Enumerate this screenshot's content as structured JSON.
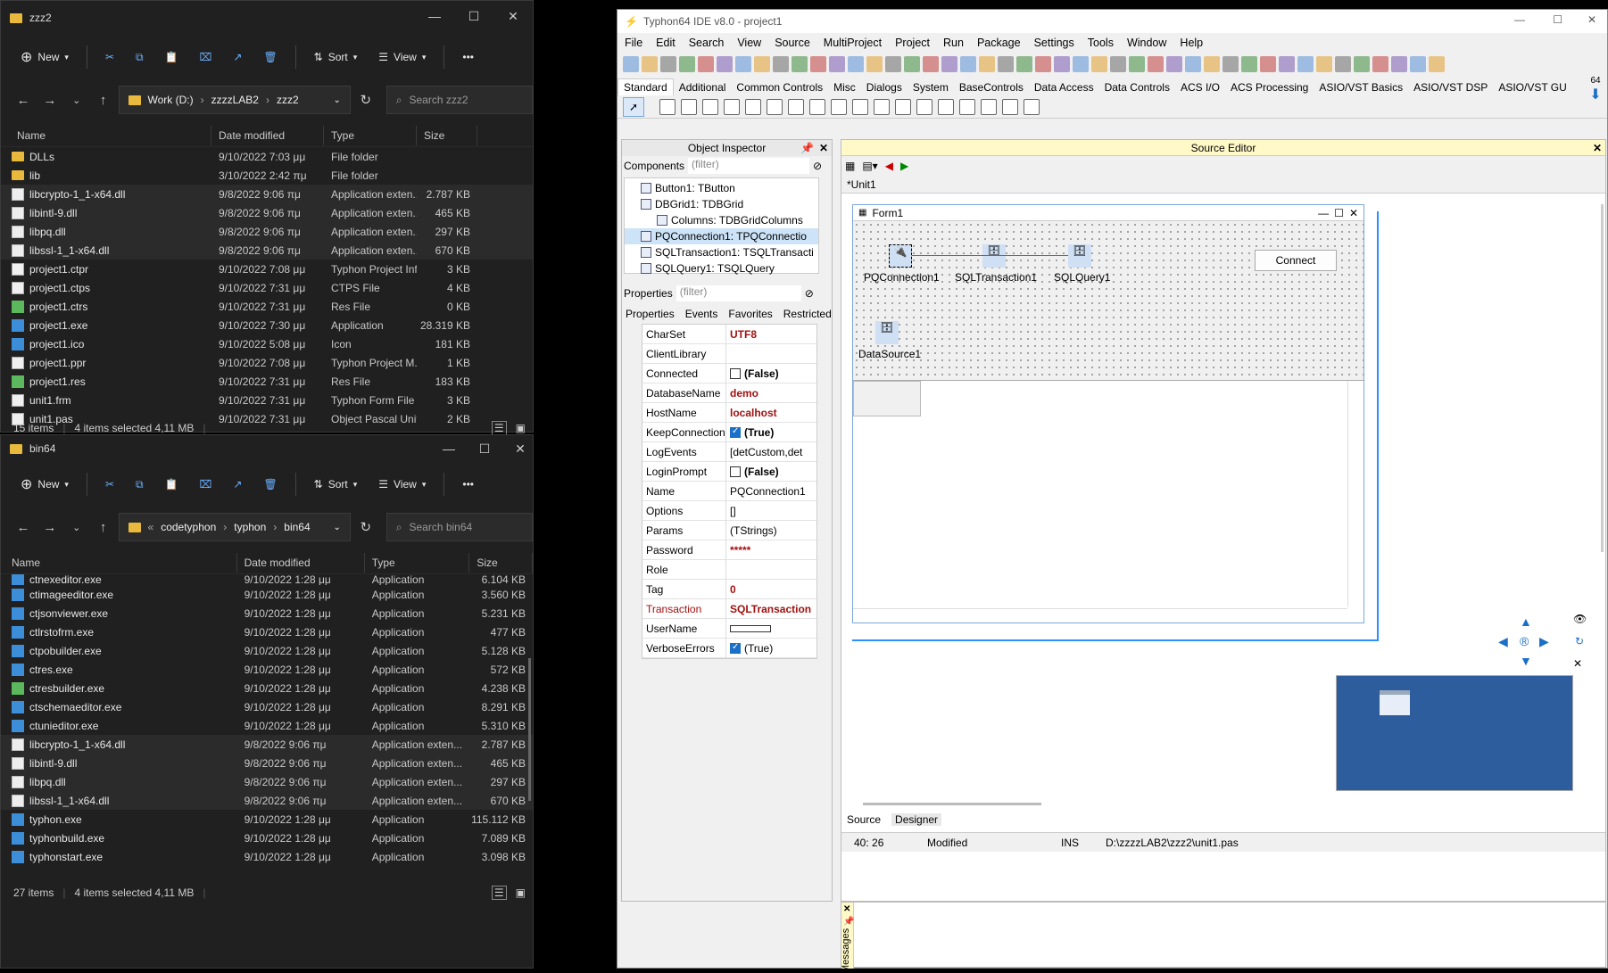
{
  "explorer1": {
    "title": "zzz2",
    "new_label": "New",
    "sort_label": "Sort",
    "view_label": "View",
    "path": [
      "Work (D:)",
      "zzzzLAB2",
      "zzz2"
    ],
    "search_placeholder": "Search zzz2",
    "columns": [
      "Name",
      "Date modified",
      "Type",
      "Size"
    ],
    "rows": [
      {
        "name": "DLLs",
        "date": "9/10/2022 7:03 μμ",
        "type": "File folder",
        "size": "",
        "icon": "folder",
        "sel": false
      },
      {
        "name": "lib",
        "date": "3/10/2022 2:42 πμ",
        "type": "File folder",
        "size": "",
        "icon": "folder",
        "sel": false
      },
      {
        "name": "libcrypto-1_1-x64.dll",
        "date": "9/8/2022 9:06 πμ",
        "type": "Application exten...",
        "size": "2.787 KB",
        "icon": "dll",
        "sel": true
      },
      {
        "name": "libintl-9.dll",
        "date": "9/8/2022 9:06 πμ",
        "type": "Application exten...",
        "size": "465 KB",
        "icon": "dll",
        "sel": true
      },
      {
        "name": "libpq.dll",
        "date": "9/8/2022 9:06 πμ",
        "type": "Application exten...",
        "size": "297 KB",
        "icon": "dll",
        "sel": true
      },
      {
        "name": "libssl-1_1-x64.dll",
        "date": "9/8/2022 9:06 πμ",
        "type": "Application exten...",
        "size": "670 KB",
        "icon": "dll",
        "sel": true
      },
      {
        "name": "project1.ctpr",
        "date": "9/10/2022 7:08 μμ",
        "type": "Typhon Project Inf...",
        "size": "3 KB",
        "icon": "project",
        "sel": false
      },
      {
        "name": "project1.ctps",
        "date": "9/10/2022 7:31 μμ",
        "type": "CTPS File",
        "size": "4 KB",
        "icon": "doc",
        "sel": false
      },
      {
        "name": "project1.ctrs",
        "date": "9/10/2022 7:31 μμ",
        "type": "Res File",
        "size": "0 KB",
        "icon": "res",
        "sel": false
      },
      {
        "name": "project1.exe",
        "date": "9/10/2022 7:30 μμ",
        "type": "Application",
        "size": "28.319 KB",
        "icon": "exe",
        "sel": false
      },
      {
        "name": "project1.ico",
        "date": "9/10/2022 5:08 μμ",
        "type": "Icon",
        "size": "181 KB",
        "icon": "exe",
        "sel": false
      },
      {
        "name": "project1.ppr",
        "date": "9/10/2022 7:08 μμ",
        "type": "Typhon Project M...",
        "size": "1 KB",
        "icon": "project",
        "sel": false
      },
      {
        "name": "project1.res",
        "date": "9/10/2022 7:31 μμ",
        "type": "Res File",
        "size": "183 KB",
        "icon": "res",
        "sel": false
      },
      {
        "name": "unit1.frm",
        "date": "9/10/2022 7:31 μμ",
        "type": "Typhon Form File",
        "size": "3 KB",
        "icon": "doc",
        "sel": false
      },
      {
        "name": "unit1.pas",
        "date": "9/10/2022 7:31 μμ",
        "type": "Object Pascal Unit",
        "size": "2 KB",
        "icon": "doc",
        "sel": false
      }
    ],
    "status_items": "15 items",
    "status_selected": "4 items selected  4,11 MB"
  },
  "explorer2": {
    "title": "bin64",
    "new_label": "New",
    "sort_label": "Sort",
    "view_label": "View",
    "path": [
      "codetyphon",
      "typhon",
      "bin64"
    ],
    "search_placeholder": "Search bin64",
    "columns": [
      "Name",
      "Date modified",
      "Type",
      "Size"
    ],
    "rows": [
      {
        "name": "ctnexeditor.exe",
        "date": "9/10/2022 1:28 μμ",
        "type": "Application",
        "size": "6.104 KB",
        "icon": "exe",
        "sel": false
      },
      {
        "name": "ctimageeditor.exe",
        "date": "9/10/2022 1:28 μμ",
        "type": "Application",
        "size": "3.560 KB",
        "icon": "exe",
        "sel": false
      },
      {
        "name": "ctjsonviewer.exe",
        "date": "9/10/2022 1:28 μμ",
        "type": "Application",
        "size": "5.231 KB",
        "icon": "exe",
        "sel": false
      },
      {
        "name": "ctlrstofrm.exe",
        "date": "9/10/2022 1:28 μμ",
        "type": "Application",
        "size": "477 KB",
        "icon": "exe",
        "sel": false
      },
      {
        "name": "ctpobuilder.exe",
        "date": "9/10/2022 1:28 μμ",
        "type": "Application",
        "size": "5.128 KB",
        "icon": "exe",
        "sel": false
      },
      {
        "name": "ctres.exe",
        "date": "9/10/2022 1:28 μμ",
        "type": "Application",
        "size": "572 KB",
        "icon": "exe",
        "sel": false
      },
      {
        "name": "ctresbuilder.exe",
        "date": "9/10/2022 1:28 μμ",
        "type": "Application",
        "size": "4.238 KB",
        "icon": "res",
        "sel": false
      },
      {
        "name": "ctschemaeditor.exe",
        "date": "9/10/2022 1:28 μμ",
        "type": "Application",
        "size": "8.291 KB",
        "icon": "exe",
        "sel": false
      },
      {
        "name": "ctunieditor.exe",
        "date": "9/10/2022 1:28 μμ",
        "type": "Application",
        "size": "5.310 KB",
        "icon": "exe",
        "sel": false
      },
      {
        "name": "libcrypto-1_1-x64.dll",
        "date": "9/8/2022 9:06 πμ",
        "type": "Application exten...",
        "size": "2.787 KB",
        "icon": "dll",
        "sel": true
      },
      {
        "name": "libintl-9.dll",
        "date": "9/8/2022 9:06 πμ",
        "type": "Application exten...",
        "size": "465 KB",
        "icon": "dll",
        "sel": true
      },
      {
        "name": "libpq.dll",
        "date": "9/8/2022 9:06 πμ",
        "type": "Application exten...",
        "size": "297 KB",
        "icon": "dll",
        "sel": true
      },
      {
        "name": "libssl-1_1-x64.dll",
        "date": "9/8/2022 9:06 πμ",
        "type": "Application exten...",
        "size": "670 KB",
        "icon": "dll",
        "sel": true
      },
      {
        "name": "typhon.exe",
        "date": "9/10/2022 1:28 μμ",
        "type": "Application",
        "size": "115.112 KB",
        "icon": "exe",
        "sel": false
      },
      {
        "name": "typhonbuild.exe",
        "date": "9/10/2022 1:28 μμ",
        "type": "Application",
        "size": "7.089 KB",
        "icon": "exe",
        "sel": false
      },
      {
        "name": "typhonstart.exe",
        "date": "9/10/2022 1:28 μμ",
        "type": "Application",
        "size": "3.098 KB",
        "icon": "exe",
        "sel": false
      }
    ],
    "status_items": "27 items",
    "status_selected": "4 items selected  4,11 MB"
  },
  "ide": {
    "title": "Typhon64 IDE v8.0 - project1",
    "menu": [
      "File",
      "Edit",
      "Search",
      "View",
      "Source",
      "MultiProject",
      "Project",
      "Run",
      "Package",
      "Settings",
      "Tools",
      "Window",
      "Help"
    ],
    "palette_tabs": [
      "Standard",
      "Additional",
      "Common Controls",
      "Misc",
      "Dialogs",
      "System",
      "BaseControls",
      "Data Access",
      "Data Controls",
      "ACS I/O",
      "ACS Processing",
      "ASIO/VST Basics",
      "ASIO/VST DSP",
      "ASIO/VST GU"
    ],
    "bitness": "64",
    "object_inspector": {
      "title": "Object Inspector",
      "components_label": "Components",
      "filter_placeholder": "(filter)",
      "tree": [
        {
          "label": "Button1: TButton",
          "indent": 1,
          "sel": false
        },
        {
          "label": "DBGrid1: TDBGrid",
          "indent": 1,
          "sel": false
        },
        {
          "label": "Columns: TDBGridColumns",
          "indent": 2,
          "sel": false
        },
        {
          "label": "PQConnection1: TPQConnectio",
          "indent": 1,
          "sel": true
        },
        {
          "label": "SQLTransaction1: TSQLTransacti",
          "indent": 1,
          "sel": false
        },
        {
          "label": "SQLQuery1: TSQLQuery",
          "indent": 1,
          "sel": false
        }
      ],
      "properties_label": "Properties",
      "prop_tabs": [
        "Properties",
        "Events",
        "Favorites",
        "Restricted"
      ],
      "props": [
        {
          "name": "CharSet",
          "value": "UTF8",
          "style": "bold",
          "check": ""
        },
        {
          "name": "ClientLibrary",
          "value": "",
          "style": "",
          "check": ""
        },
        {
          "name": "Connected",
          "value": "(False)",
          "style": "boldblack",
          "check": "off"
        },
        {
          "name": "DatabaseName",
          "value": "demo",
          "style": "bold",
          "check": ""
        },
        {
          "name": "HostName",
          "value": "localhost",
          "style": "bold",
          "check": ""
        },
        {
          "name": "KeepConnection",
          "value": "(True)",
          "style": "boldblack",
          "check": "on"
        },
        {
          "name": "LogEvents",
          "value": "[detCustom,det",
          "style": "",
          "check": ""
        },
        {
          "name": "LoginPrompt",
          "value": "(False)",
          "style": "boldblack",
          "check": "off"
        },
        {
          "name": "Name",
          "value": "PQConnection1",
          "style": "",
          "check": ""
        },
        {
          "name": "Options",
          "value": "[]",
          "style": "",
          "check": ""
        },
        {
          "name": "Params",
          "value": "(TStrings)",
          "style": "",
          "check": ""
        },
        {
          "name": "Password",
          "value": "*****",
          "style": "bold",
          "check": ""
        },
        {
          "name": "Role",
          "value": "",
          "style": "",
          "check": ""
        },
        {
          "name": "Tag",
          "value": "0",
          "style": "bold",
          "check": ""
        },
        {
          "name": "Transaction",
          "value": "SQLTransaction",
          "style": "boldred",
          "check": ""
        },
        {
          "name": "UserName",
          "value": "",
          "style": "",
          "check": "box"
        },
        {
          "name": "VerboseErrors",
          "value": "(True)",
          "style": "",
          "check": "on"
        }
      ]
    },
    "source_editor": {
      "title": "Source Editor",
      "tab": "*Unit1",
      "form_title": "Form1",
      "components": [
        "PQConnection1",
        "SQLTransaction1",
        "SQLQuery1",
        "DataSource1"
      ],
      "button_label": "Connect",
      "bottom_tabs": [
        "Source",
        "Designer"
      ],
      "status": {
        "pos": "40: 26",
        "state": "Modified",
        "mode": "INS",
        "file": "D:\\zzzzLAB2\\zzz2\\unit1.pas"
      },
      "messages_label": "Messages"
    }
  }
}
